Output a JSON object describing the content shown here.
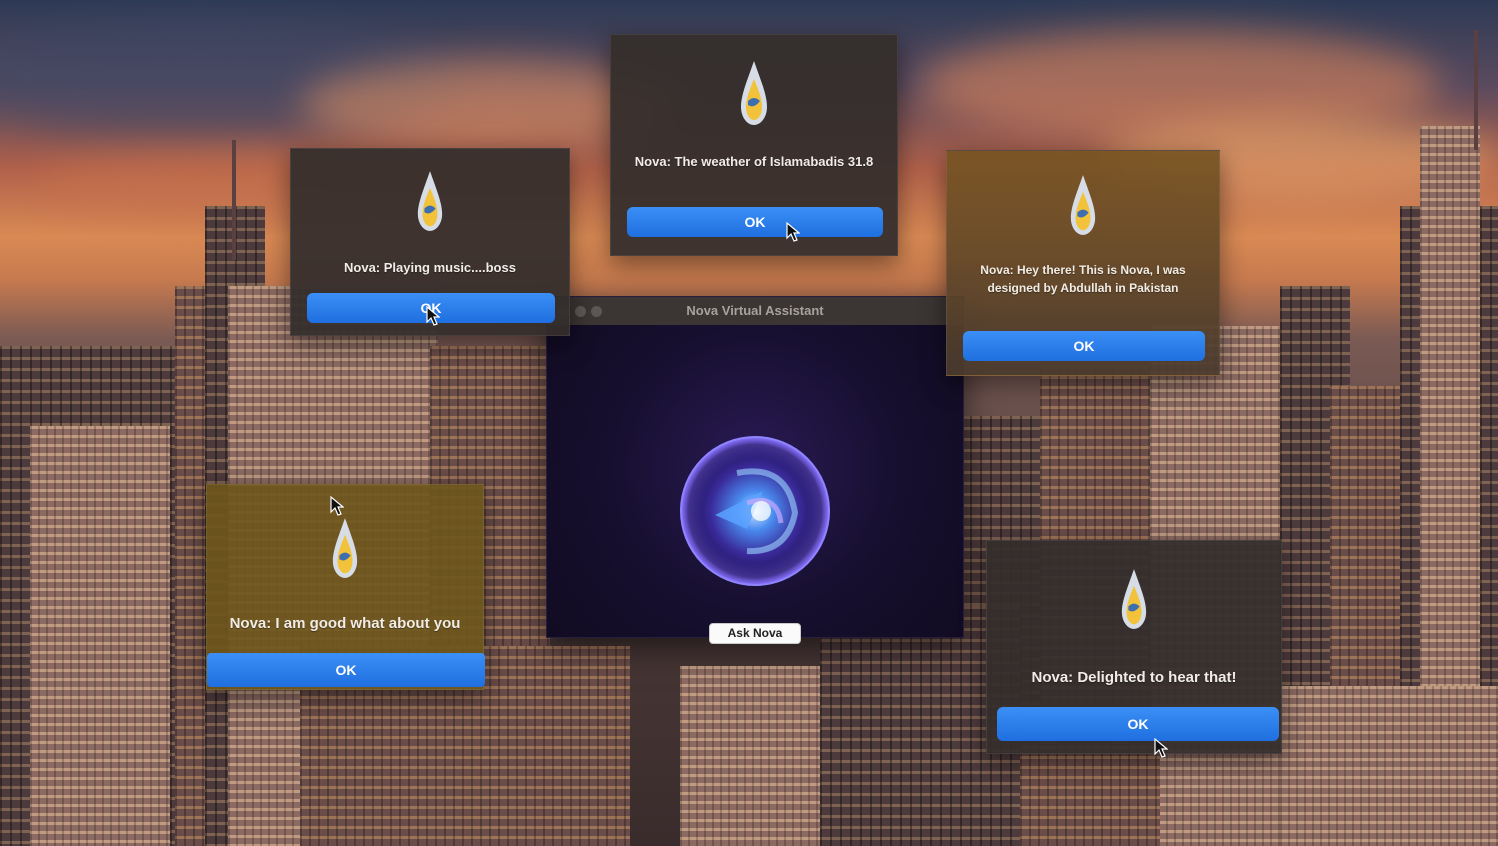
{
  "colors": {
    "ok_button": "#2a7ff0",
    "dialog_bg": "#342e2c",
    "window_bg": "#1a1230",
    "accent_orb": "#6a4cff"
  },
  "main_window": {
    "title": "Nova Virtual Assistant",
    "ask_button": "Ask Nova",
    "orb_icon": "voice-orb-icon"
  },
  "dialogs": [
    {
      "id": "weather",
      "icon": "nova-flame-icon",
      "message": "Nova: The weather of Islamabadis 31.8",
      "button": "OK"
    },
    {
      "id": "music",
      "icon": "nova-flame-icon",
      "message": "Nova: Playing music....boss",
      "button": "OK"
    },
    {
      "id": "intro",
      "icon": "nova-flame-icon",
      "message": "Nova:  Hey there! This is Nova, I was designed by Abdullah in Pakistan",
      "button": "OK"
    },
    {
      "id": "good",
      "icon": "nova-flame-icon",
      "message": "Nova: I am good what about you",
      "button": "OK"
    },
    {
      "id": "delighted",
      "icon": "nova-flame-icon",
      "message": "Nova: Delighted to hear that!",
      "button": "OK"
    }
  ]
}
